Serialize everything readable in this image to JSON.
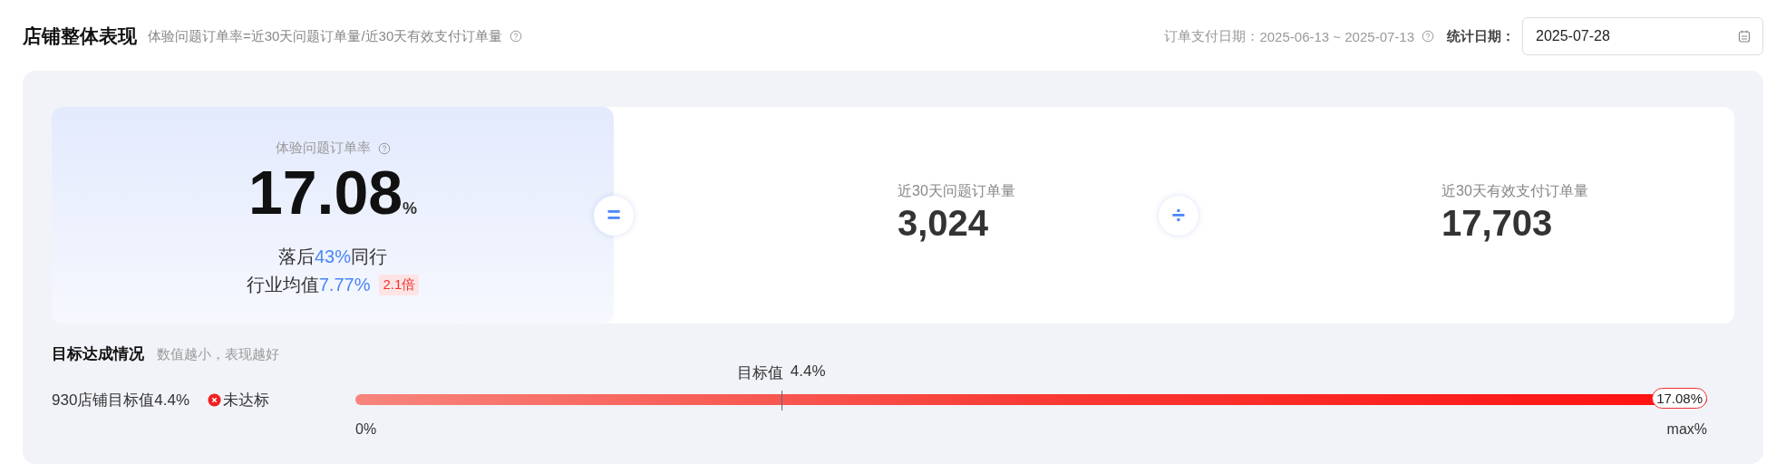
{
  "header": {
    "title": "店铺整体表现",
    "formula": "体验问题订单率=近30天问题订单量/近30天有效支付订单量",
    "pay_date_label": "订单支付日期：",
    "pay_date_range": "2025-06-13 ~ 2025-07-13",
    "stat_date_label": "统计日期：",
    "stat_date_value": "2025-07-28"
  },
  "main_metric": {
    "label": "体验问题订单率",
    "value": "17.08",
    "unit": "%",
    "rank_text": "落后**43%**同行",
    "industry_label": "行业均值",
    "industry_value": "7.77%",
    "multiple_badge": "2.1倍"
  },
  "operators": [
    {
      "symbol": "="
    },
    {
      "symbol": "÷"
    }
  ],
  "metrics": [
    {
      "label": "近30天问题订单量",
      "value": "3,024"
    },
    {
      "label": "近30天有效支付订单量",
      "value": "17,703"
    }
  ],
  "goal": {
    "title": "目标达成情况",
    "hint": "数值越小，表现越好",
    "target_text": "930店铺目标值4.4%",
    "met": false,
    "status": "未达标",
    "bar": {
      "start_label": "0%",
      "end_label": "max%",
      "current": "17.08%",
      "marker": {
        "label": "目标值",
        "value": "4.4%",
        "level": 0.315
      }
    }
  }
}
